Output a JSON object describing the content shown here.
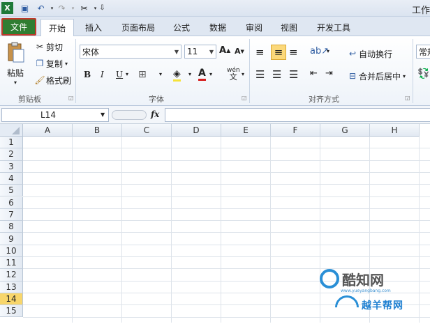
{
  "title_bar": {
    "title": "工作"
  },
  "tabs": [
    {
      "label": "文件"
    },
    {
      "label": "开始"
    },
    {
      "label": "插入"
    },
    {
      "label": "页面布局"
    },
    {
      "label": "公式"
    },
    {
      "label": "数据"
    },
    {
      "label": "审阅"
    },
    {
      "label": "视图"
    },
    {
      "label": "开发工具"
    }
  ],
  "clipboard": {
    "paste": "粘贴",
    "cut": "剪切",
    "copy": "复制",
    "format_painter": "格式刷",
    "group_label": "剪贴板"
  },
  "font": {
    "name": "宋体",
    "size": "11",
    "group_label": "字体",
    "bold": "B",
    "italic": "I",
    "underline": "U",
    "font_color_glyph": "A",
    "wen_glyph": "wén"
  },
  "alignment": {
    "wrap_text": "自动换行",
    "merge_center": "合并后居中",
    "group_label": "对齐方式"
  },
  "number": {
    "format": "常规"
  },
  "formula_bar": {
    "name_box": "L14",
    "fx": "fx",
    "content": ""
  },
  "columns": [
    "A",
    "B",
    "C",
    "D",
    "E",
    "F",
    "G",
    "H"
  ],
  "rows": [
    "1",
    "2",
    "3",
    "4",
    "5",
    "6",
    "7",
    "8",
    "9",
    "10",
    "11",
    "12",
    "13",
    "14",
    "15"
  ],
  "active_row": "14",
  "watermark": {
    "brand": "酷知网",
    "url": "www.yueyangbang.com",
    "site": "越羊帮网"
  }
}
